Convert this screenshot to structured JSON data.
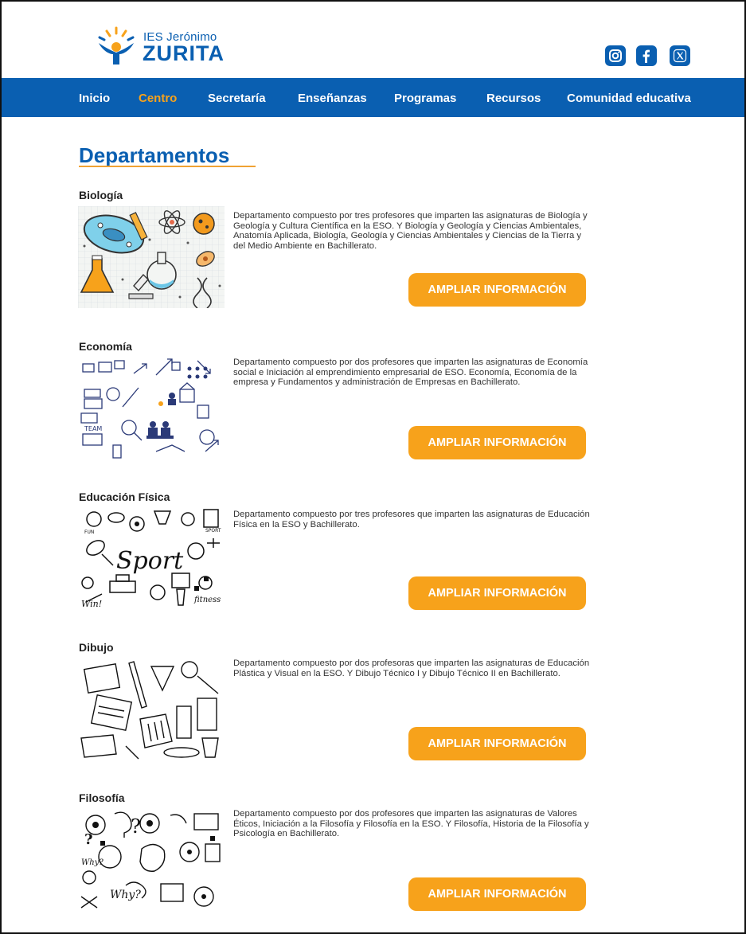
{
  "site": {
    "logo_small": "IES Jerónimo",
    "logo_big": "ZURITA"
  },
  "social": {
    "icons": [
      "instagram-icon",
      "facebook-icon",
      "x-twitter-icon"
    ]
  },
  "nav": {
    "items": [
      {
        "label": "Inicio",
        "active": false
      },
      {
        "label": "Centro",
        "active": true
      },
      {
        "label": "Secretaría",
        "active": false
      },
      {
        "label": "Enseñanzas",
        "active": false
      },
      {
        "label": "Programas",
        "active": false
      },
      {
        "label": "Recursos",
        "active": false
      },
      {
        "label": "Comunidad educativa",
        "active": false
      }
    ]
  },
  "page": {
    "title": "Departamentos"
  },
  "departments": [
    {
      "name": "Biología",
      "description": "Departamento compuesto por tres profesores que imparten las asignaturas de Biología y Geología y Cultura Científica en la ESO. Y Biología y Geología y Ciencias Ambientales, Anatomía Aplicada, Biología, Geología y Ciencias Ambientales y Ciencias de la Tierra y del Medio Ambiente en Bachillerato.",
      "button": "AMPLIAR INFORMACIÓN"
    },
    {
      "name": "Economía",
      "description": "Departamento compuesto por dos profesores que imparten las asignaturas de Economía social e Iniciación al emprendimiento empresarial de ESO. Economía, Economía de la empresa y Fundamentos y administración de Empresas en Bachillerato.",
      "button": "AMPLIAR INFORMACIÓN"
    },
    {
      "name": "Educación Física",
      "description": "Departamento compuesto por tres profesores que imparten las asignaturas de Educación Física en la ESO y Bachillerato.",
      "button": "AMPLIAR INFORMACIÓN",
      "image_text": [
        "Sport",
        "fitness",
        "Win!",
        "SPORT",
        "FUN"
      ]
    },
    {
      "name": "Dibujo",
      "description": "Departamento compuesto por dos profesoras que imparten las asignaturas de Educación Plástica y Visual en la ESO.  Y Dibujo Técnico I y Dibujo Técnico II en Bachillerato.",
      "button": "AMPLIAR INFORMACIÓN"
    },
    {
      "name": "Filosofía",
      "description": "Departamento compuesto por dos profesores que imparten las asignaturas de Valores Éticos, Iniciación a la Filosofía y Filosofía en la ESO. Y Filosofía, Historia de la Filosofía y Psicología en Bachillerato.",
      "button": "AMPLIAR INFORMACIÓN",
      "image_text": [
        "Why?",
        "Why?"
      ]
    }
  ],
  "colors": {
    "brand_blue": "#0a5fb1",
    "accent_orange": "#f7a21b"
  }
}
